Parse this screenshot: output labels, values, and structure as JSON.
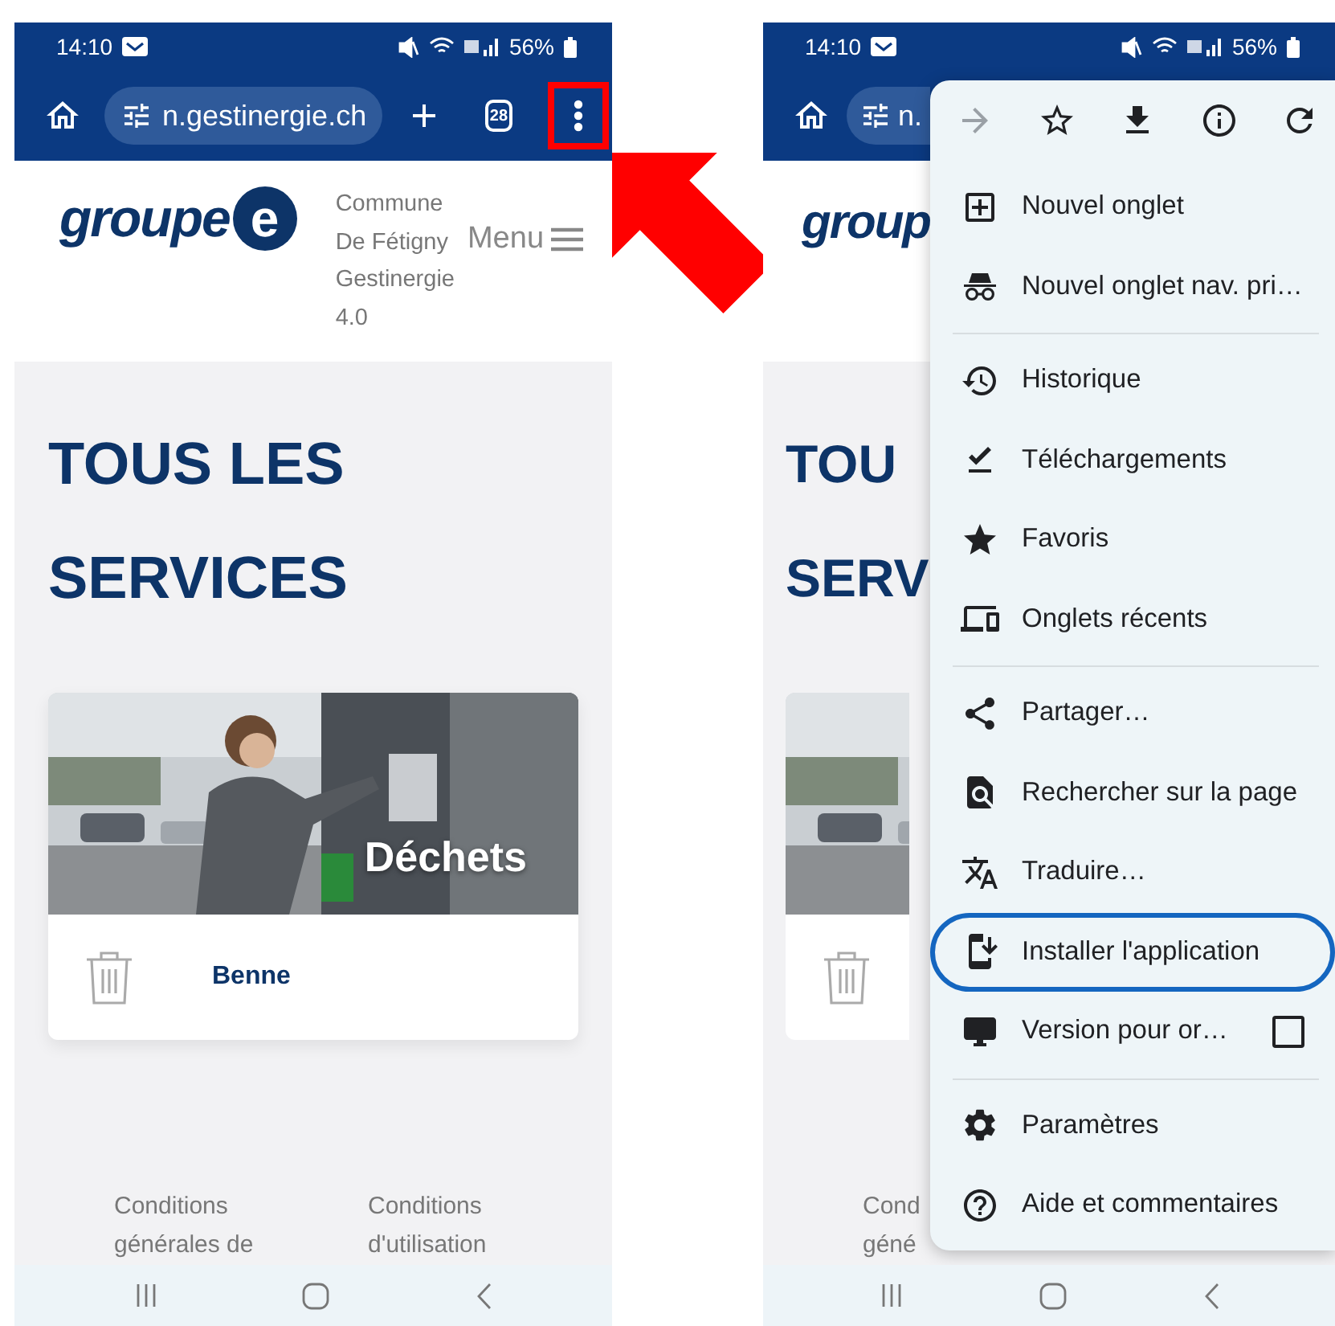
{
  "left_screen": {
    "status_bar": {
      "time": "14:10",
      "battery": "56%"
    },
    "toolbar": {
      "url": "n.gestinergie.ch",
      "tab_count": "28",
      "menu_highlighted": true
    },
    "header": {
      "logo_text": "groupe",
      "logo_mark": "e",
      "commune_lines": [
        "Commune",
        "De Fétigny",
        "Gestinergie",
        "4.0"
      ],
      "menu_label": "Menu"
    },
    "heading": "TOUS LES SERVICES",
    "card": {
      "title": "Déchets",
      "item": "Benne"
    },
    "footer_links": [
      "Conditions générales de",
      "Conditions d'utilisation"
    ]
  },
  "right_screen": {
    "status_bar": {
      "time": "14:10",
      "battery": "56%"
    },
    "toolbar": {
      "url": "n."
    },
    "header": {
      "logo_text": "group"
    },
    "heading_lines": [
      "TOU",
      "SERV"
    ],
    "footer_fragments": [
      "Cond",
      "géné"
    ],
    "menu": {
      "actions": [
        {
          "kind": "forward",
          "disabled": true
        },
        {
          "kind": "bookmark",
          "disabled": false
        },
        {
          "kind": "download",
          "disabled": false
        },
        {
          "kind": "info",
          "disabled": false
        },
        {
          "kind": "reload",
          "disabled": false
        }
      ],
      "groups": [
        {
          "items": [
            {
              "label": "Nouvel onglet",
              "kind": "new-tab",
              "highlighted": false
            },
            {
              "label": "Nouvel onglet nav. pri…",
              "kind": "incognito",
              "highlighted": false
            }
          ]
        },
        {
          "items": [
            {
              "label": "Historique",
              "kind": "history",
              "highlighted": false
            },
            {
              "label": "Téléchargements",
              "kind": "downloads",
              "highlighted": false
            },
            {
              "label": "Favoris",
              "kind": "bookmarks",
              "highlighted": false
            },
            {
              "label": "Onglets récents",
              "kind": "recent-tabs",
              "highlighted": false
            }
          ]
        },
        {
          "items": [
            {
              "label": "Partager…",
              "kind": "share",
              "highlighted": false
            },
            {
              "label": "Rechercher sur la page",
              "kind": "find",
              "highlighted": false
            },
            {
              "label": "Traduire…",
              "kind": "translate",
              "highlighted": false
            },
            {
              "label": "Installer l'application",
              "kind": "install",
              "highlighted": true
            },
            {
              "label": "Version pour or…",
              "kind": "desktop-site",
              "checked": false,
              "highlighted": false
            }
          ]
        },
        {
          "items": [
            {
              "label": "Paramètres",
              "kind": "settings",
              "highlighted": false
            },
            {
              "label": "Aide et commentaires",
              "kind": "help",
              "highlighted": false
            }
          ]
        }
      ]
    }
  }
}
